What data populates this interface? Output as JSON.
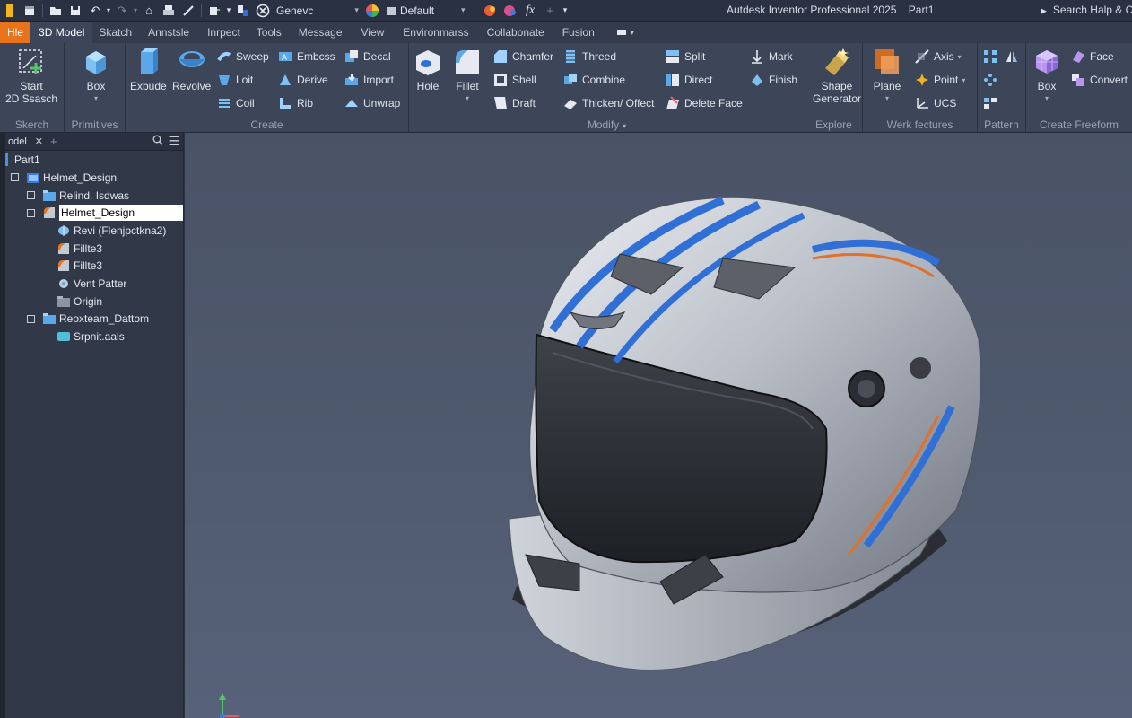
{
  "app": {
    "title": "Autdesk Inventor Professional 2025",
    "document": "Part1",
    "search_help": "Search Halp & C"
  },
  "quick_access": {
    "appearance_combo": "Genevc",
    "material_combo": "Default",
    "fx_label": "fx"
  },
  "tabs": [
    {
      "label": "Hle"
    },
    {
      "label": "3D Model"
    },
    {
      "label": "Skatch"
    },
    {
      "label": "Annstsle"
    },
    {
      "label": "Inrpect"
    },
    {
      "label": "Tools"
    },
    {
      "label": "Message"
    },
    {
      "label": "View"
    },
    {
      "label": "Environmarss"
    },
    {
      "label": "Collabonate"
    },
    {
      "label": "Fusion"
    }
  ],
  "ribbon": {
    "sketch": {
      "title": "Skerch",
      "start_line1": "Start",
      "start_line2": "2D Ssasch"
    },
    "primitives": {
      "title": "Primitives",
      "box": "Box"
    },
    "create": {
      "title": "Create",
      "extrude": "Exbude",
      "revolve": "Revolve",
      "sweep": "Sweep",
      "loft": "Loit",
      "coil": "Coil",
      "emboss": "Embcss",
      "derive": "Derive",
      "rib": "Rib",
      "decal": "Decal",
      "import": "Import",
      "unwrap": "Unwrap"
    },
    "modify": {
      "title": "Modify",
      "hole": "Hole",
      "fillet": "Fillet",
      "chamfer": "Chamfer",
      "shell": "Shell",
      "draft": "Draft",
      "thread": "Threed",
      "combine": "Combine",
      "thicken": "Thicken/ Offect",
      "split": "Split",
      "direct": "Direct",
      "delete_face": "Delete Face",
      "mark": "Mark",
      "finish": "Finish"
    },
    "explore": {
      "title": "Explore",
      "shape_line1": "Shape",
      "shape_line2": "Generator"
    },
    "work_features": {
      "title": "Werk fectures",
      "plane": "Plane",
      "axis": "Axis",
      "point": "Point",
      "ucs": "UCS"
    },
    "pattern": {
      "title": "Pattern"
    },
    "create_freeform": {
      "title": "Create Freeform",
      "box": "Box",
      "face": "Face",
      "convert": "Convert"
    }
  },
  "browser": {
    "tab_label": "odel",
    "part": "Part1",
    "tree": [
      {
        "label": "Helmet_Design",
        "expander": true,
        "icon": "part-icon",
        "indent": 0
      },
      {
        "label": "Relind. Isdwas",
        "expander": true,
        "icon": "folder-icon",
        "indent": 1
      },
      {
        "label": "Helmet_Design",
        "expander": true,
        "icon": "fillet-feature-icon",
        "indent": 1,
        "editing": true
      },
      {
        "label": "Revi (Flenjpctkna2)",
        "expander": false,
        "icon": "revolve-feature-icon",
        "indent": 2
      },
      {
        "label": "Fillte3",
        "expander": false,
        "icon": "fillet-feature-icon",
        "indent": 2
      },
      {
        "label": "Fillte3",
        "expander": false,
        "icon": "fillet-feature-icon",
        "indent": 2
      },
      {
        "label": "Vent Patter",
        "expander": false,
        "icon": "pattern-feature-icon",
        "indent": 2
      },
      {
        "label": "Origin",
        "expander": false,
        "icon": "origin-folder-icon",
        "indent": 2
      },
      {
        "label": "Reoxteam_Dattom",
        "expander": true,
        "icon": "folder-icon",
        "indent": 1
      },
      {
        "label": "Srpnit.aals",
        "expander": false,
        "icon": "surface-icon",
        "indent": 2
      }
    ]
  },
  "colors": {
    "accent": "#e8731a",
    "stripe_blue": "#2f6fd6",
    "stripe_orange": "#e0702a",
    "viewport_bg": "#4f596d"
  }
}
